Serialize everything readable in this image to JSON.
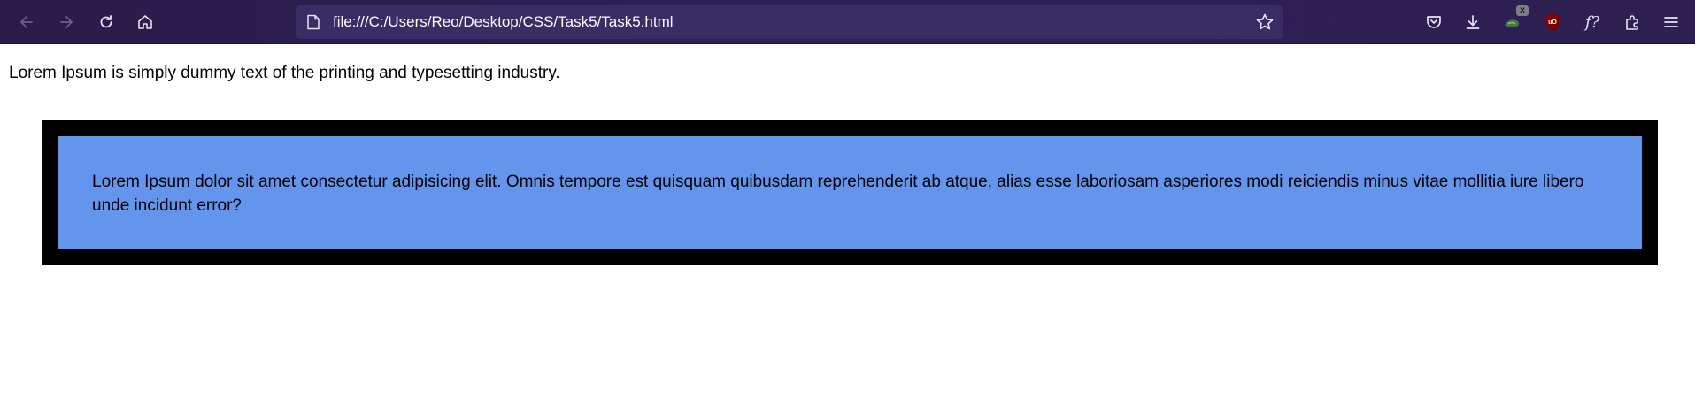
{
  "browser": {
    "url": "file:///C:/Users/Reo/Desktop/CSS/Task5/Task5.html",
    "toolbar_buttons": [
      "back-icon",
      "forward-icon",
      "reload-icon",
      "home-icon"
    ],
    "right_buttons": [
      "pocket-icon",
      "download-icon",
      "extension-icon",
      "ublock-icon",
      "function-icon",
      "extensions-puzzle-icon",
      "menu-icon"
    ],
    "ext_badge": "X",
    "ublock_label": "uO",
    "fx_label": "f?"
  },
  "page": {
    "intro": "Lorem Ipsum is simply dummy text of the printing and typesetting industry.",
    "box_text": "Lorem Ipsum dolor sit amet consectetur adipisicing elit. Omnis tempore est quisquam quibusdam reprehenderit ab atque, alias esse laboriosam asperiores modi reiciendis minus vitae mollitia iure libero unde incidunt error?",
    "colors": {
      "outer_border": "#000000",
      "inner_background": "#6495ed"
    }
  }
}
